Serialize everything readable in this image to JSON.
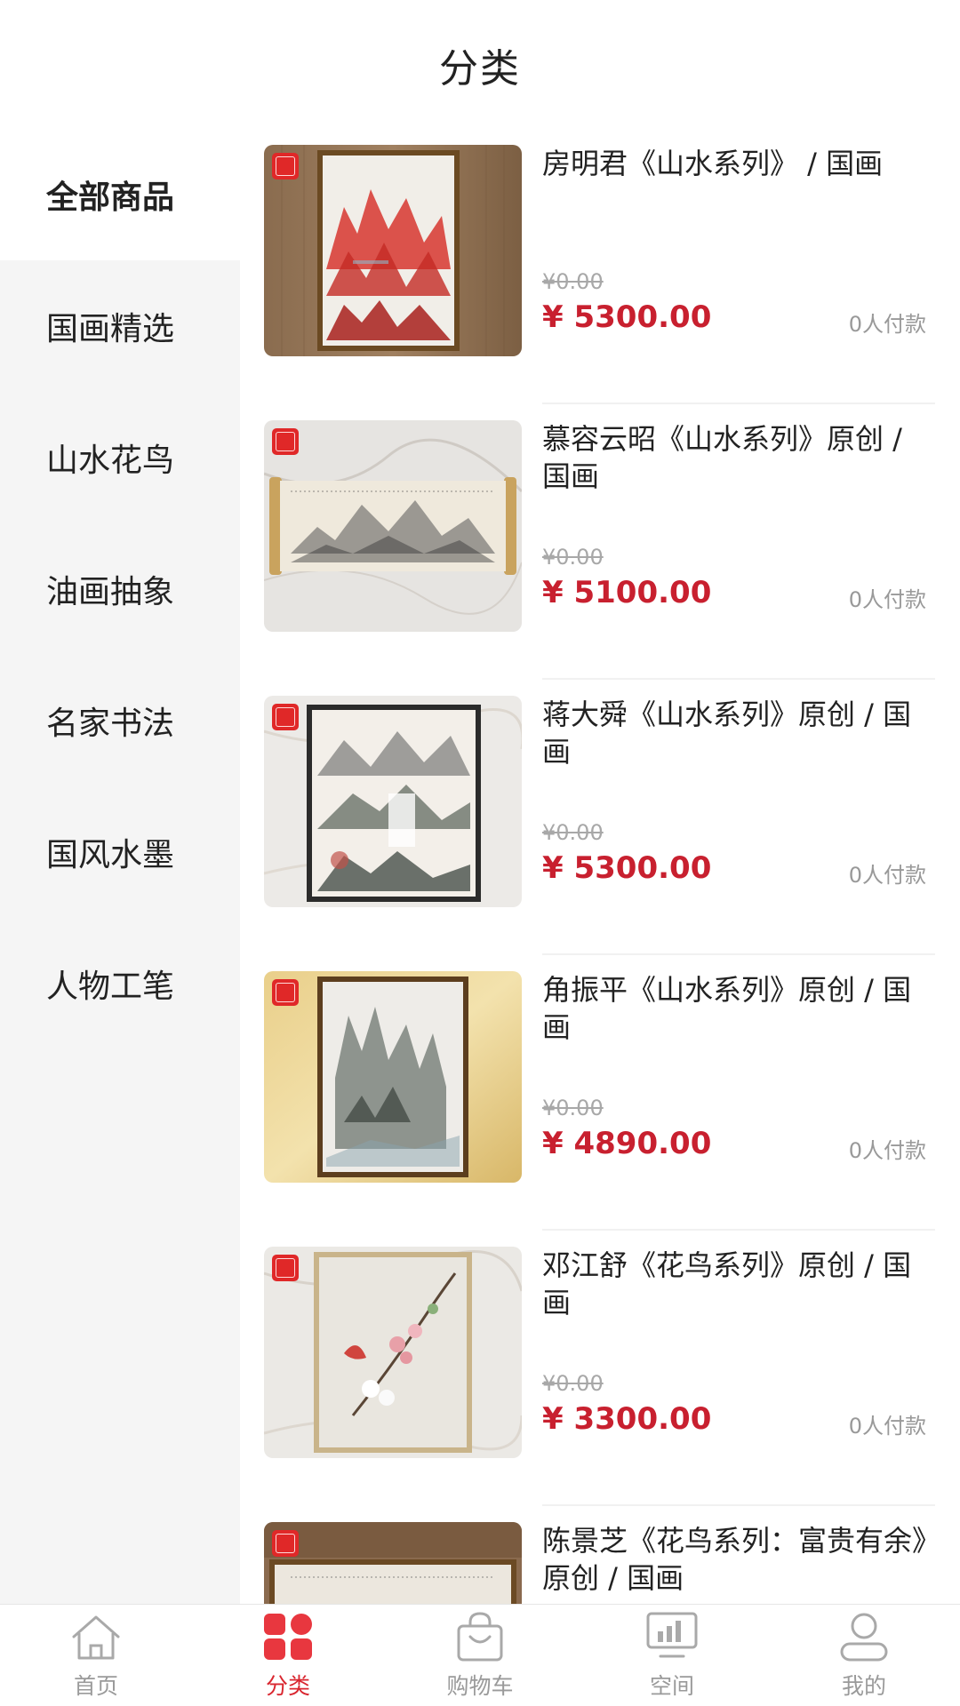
{
  "header": {
    "title": "分类"
  },
  "categories": [
    {
      "label": "全部商品",
      "active": true
    },
    {
      "label": "国画精选",
      "active": false
    },
    {
      "label": "山水花鸟",
      "active": false
    },
    {
      "label": "油画抽象",
      "active": false
    },
    {
      "label": "名家书法",
      "active": false
    },
    {
      "label": "国风水墨",
      "active": false
    },
    {
      "label": "人物工笔",
      "active": false
    }
  ],
  "products": [
    {
      "name": "房明君《山水系列》 / 国画",
      "original_price": "¥0.00",
      "price": "¥ 5300.00",
      "sold": "0人付款"
    },
    {
      "name": "慕容云昭《山水系列》原创 / 国画",
      "original_price": "¥0.00",
      "price": "¥ 5100.00",
      "sold": "0人付款"
    },
    {
      "name": "蒋大舜《山水系列》原创 / 国画",
      "original_price": "¥0.00",
      "price": "¥ 5300.00",
      "sold": "0人付款"
    },
    {
      "name": "角振平《山水系列》原创 / 国画",
      "original_price": "¥0.00",
      "price": "¥ 4890.00",
      "sold": "0人付款"
    },
    {
      "name": "邓江舒《花鸟系列》原创 / 国画",
      "original_price": "¥0.00",
      "price": "¥ 3300.00",
      "sold": "0人付款"
    },
    {
      "name": "陈景芝《花鸟系列：富贵有余》原创 / 国画",
      "original_price": "",
      "price": "",
      "sold": ""
    }
  ],
  "tabbar": {
    "items": [
      {
        "label": "首页",
        "icon": "home-icon",
        "active": false
      },
      {
        "label": "分类",
        "icon": "category-grid-icon",
        "active": true
      },
      {
        "label": "购物车",
        "icon": "cart-bag-icon",
        "active": false
      },
      {
        "label": "空间",
        "icon": "space-chart-icon",
        "active": false
      },
      {
        "label": "我的",
        "icon": "user-icon",
        "active": false
      }
    ]
  },
  "colors": {
    "accent": "#d9262f",
    "price": "#c8202f",
    "sidebar_bg": "#f5f5f5"
  }
}
